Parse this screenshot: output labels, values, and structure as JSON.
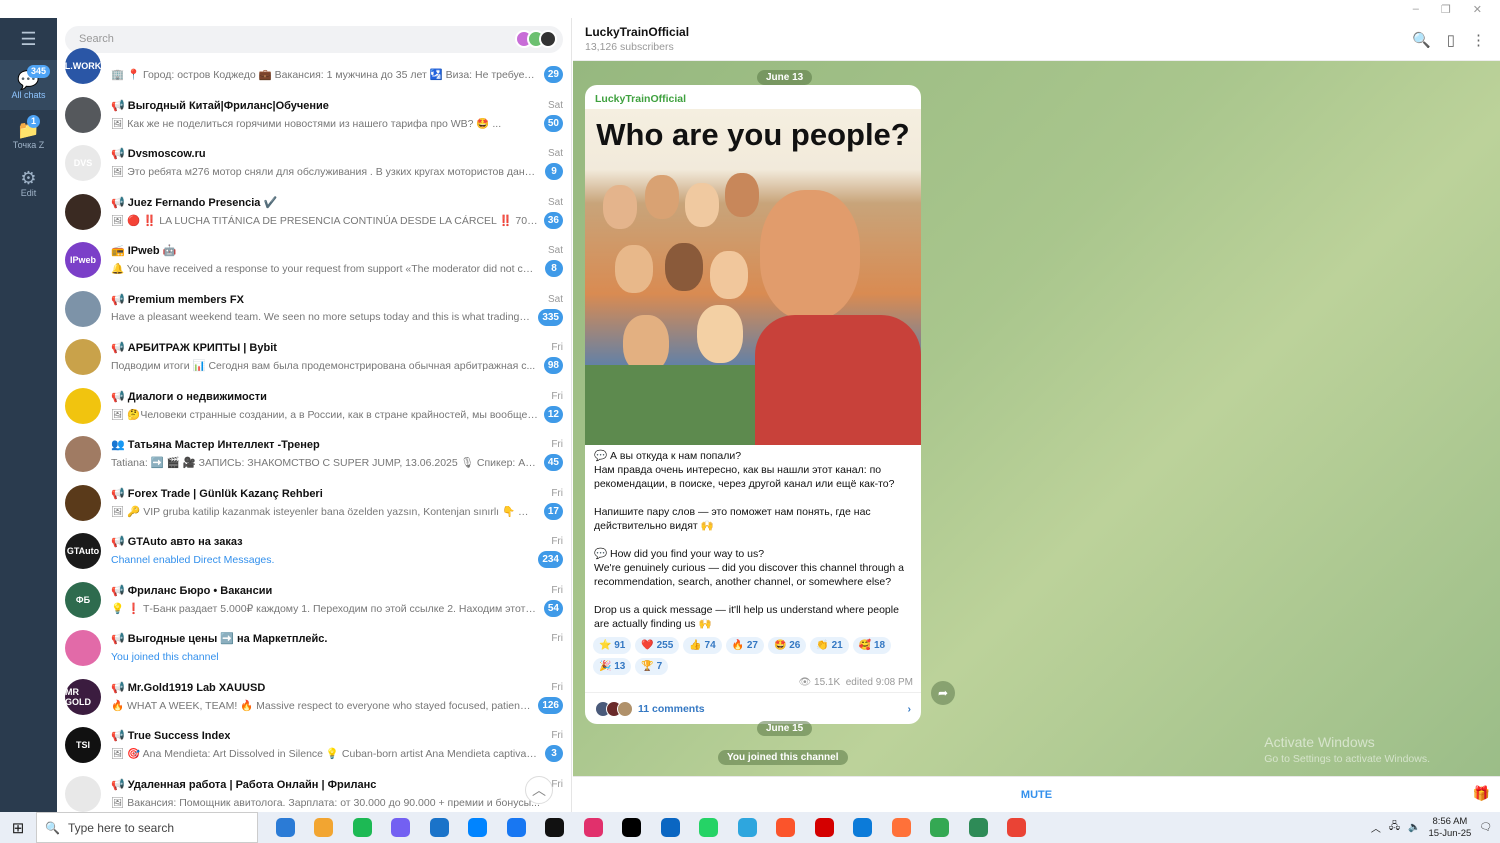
{
  "window": {
    "controls": [
      "–",
      "❐",
      "✕"
    ]
  },
  "rail": {
    "menu_icon": "hamburger-icon",
    "all_chats": {
      "label": "All chats",
      "badge": "345"
    },
    "folder": {
      "label": "Точка Z",
      "badge": "1"
    },
    "edit": {
      "label": "Edit"
    }
  },
  "search": {
    "placeholder": "Search"
  },
  "chats": [
    {
      "name": "",
      "date": "",
      "msg": "🏢 📍 Город: остров Коджедо 💼 Вакансия: 1 мужчина до 35 лет 🛂 Виза: Не требуетс...",
      "badge": "29",
      "avatar_color": "#2a56a6",
      "avatar_text": "L.WORK"
    },
    {
      "name": "📢 Выгодный Китай|Фриланс|Обучение",
      "date": "Sat",
      "msg": "🖼 Как же не поделиться горячими новостями из нашего тарифа про WB? 🤩 ...",
      "badge": "50",
      "avatar_color": "#55585c",
      "avatar_text": ""
    },
    {
      "name": "📢 Dvsmoscow.ru",
      "date": "Sat",
      "msg": "🖼 Это ребята м276 мотор сняли для обслуживания . В узких кругах мотористов данны...",
      "badge": "9",
      "avatar_color": "#e9e9e9",
      "avatar_text": "DVS"
    },
    {
      "name": "📢 Juez Fernando Presencia ✔️",
      "date": "Sat",
      "msg": "🖼 🔴 ‼️ LA LUCHA TITÁNICA DE PRESENCIA CONTINÚA DESDE LA CÁRCEL ‼️ 709 días secu...",
      "badge": "36",
      "avatar_color": "#3a2a22",
      "avatar_text": ""
    },
    {
      "name": "📻 IPweb 🤖",
      "date": "Sat",
      "msg": "🔔 You have received a response to your request from support «The moderator did not con...",
      "badge": "8",
      "avatar_color": "#7b3fc8",
      "avatar_text": "IPweb"
    },
    {
      "name": "📢 Premium members FX",
      "date": "Sat",
      "msg": "Have a pleasant weekend team. We seen no more setups today and this is what trading is l...",
      "badge": "335",
      "avatar_color": "#7d93a8",
      "avatar_text": ""
    },
    {
      "name": "📢 АРБИТРАЖ КРИПТЫ | Bybit",
      "date": "Fri",
      "msg": "Подводим итоги 📊 Сегодня вам была продемонстрирована обычная арбитражная с...",
      "badge": "98",
      "avatar_color": "#c9a24a",
      "avatar_text": ""
    },
    {
      "name": "📢 Диалоги о недвижимости",
      "date": "Fri",
      "msg": "🖼 🤔Человеки странные создании, а в России, как в стране крайностей, мы вообще п...",
      "badge": "12",
      "avatar_color": "#f1c40f",
      "avatar_text": ""
    },
    {
      "name": "👥 Татьяна Мастер Интеллект -Тренер",
      "date": "Fri",
      "msg": "Tatiana: ➡️ 🎬 🎥 ЗАПИСЬ: ЗНАКОМСТВО С SUPER JUMP, 13.06.2025 🎙 Спикер: Артём Я...",
      "badge": "45",
      "avatar_color": "#a07b63",
      "avatar_text": ""
    },
    {
      "name": "📢 Forex Trade | Günlük Kazanç Rehberi",
      "date": "Fri",
      "msg": "🖼 🔑 VIP gruba katilip kazanmak isteyenler bana özelden yazsın, Kontenjan sınırlı 👇 👇 ...",
      "badge": "17",
      "avatar_color": "#5a3a1a",
      "avatar_text": ""
    },
    {
      "name": "📢 GTAuto авто на заказ",
      "date": "Fri",
      "msg": "Channel enabled Direct Messages.",
      "badge": "234",
      "avatar_color": "#1a1a1a",
      "avatar_text": "GTAuto",
      "msg_blue": true
    },
    {
      "name": "📢 Фриланс Бюро • Вакансии",
      "date": "Fri",
      "msg": "💡 ❗ Т-Банк раздает 5.000₽ каждому 1. Переходим по этой ссылке 2. Находим этот по...",
      "badge": "54",
      "avatar_color": "#2e6b4e",
      "avatar_text": "ФБ"
    },
    {
      "name": "📢 Выгодные цены ➡️ на Маркетплейс.",
      "date": "Fri",
      "msg": "You joined this channel",
      "badge": "",
      "avatar_color": "#e26aa8",
      "avatar_text": "",
      "msg_blue": true
    },
    {
      "name": "📢 Mr.Gold1919 Lab XAUUSD",
      "date": "Fri",
      "msg": "🔥 WHAT A WEEK, TEAM! 🔥 Massive respect to everyone who stayed focused, patient, a...",
      "badge": "126",
      "avatar_color": "#3b1c3f",
      "avatar_text": "MR GOLD"
    },
    {
      "name": "📢 True Success Index",
      "date": "Fri",
      "msg": "🖼 🎯 Ana Mendieta: Art Dissolved in Silence 💡 Cuban-born artist Ana Mendieta captivate...",
      "badge": "3",
      "avatar_color": "#111111",
      "avatar_text": "TSI"
    },
    {
      "name": "📢 Удаленная работа | Работа Онлайн | Фриланс",
      "date": "Fri",
      "msg": "🖼 Вакансия: Помощник авитолога. Зарплата: от 30.000 до 90.000 + премии и бонусы...",
      "badge": "",
      "avatar_color": "#e8e8e8",
      "avatar_text": ""
    }
  ],
  "channel": {
    "title": "LuckyTrainOfficial",
    "subscribers": "13,126 subscribers"
  },
  "messages": {
    "date1": "June 13",
    "author": "LuckyTrainOfficial",
    "image_caption": "Who are you people?",
    "text": [
      "💬 А вы откуда к нам попали?",
      "Нам правда очень интересно, как вы нашли этот канал: по рекомендации, в поиске, через другой канал или ещё как-то?",
      "",
      "Напишите пару слов — это поможет нам понять, где нас действительно видят 🙌",
      "",
      "💬 How did you find your way to us?",
      "We're genuinely curious — did you discover this channel through a recommendation, search, another channel, or somewhere else?",
      "",
      "Drop us a quick message — it'll help us understand where people are actually finding us 🙌"
    ],
    "reactions": [
      {
        "emoji": "⭐",
        "count": "91"
      },
      {
        "emoji": "❤️",
        "count": "255"
      },
      {
        "emoji": "👍",
        "count": "74"
      },
      {
        "emoji": "🔥",
        "count": "27"
      },
      {
        "emoji": "🤩",
        "count": "26"
      },
      {
        "emoji": "👏",
        "count": "21"
      },
      {
        "emoji": "🥰",
        "count": "18"
      },
      {
        "emoji": "🎉",
        "count": "13"
      },
      {
        "emoji": "🏆",
        "count": "7"
      }
    ],
    "views": "15.1K",
    "edited": "edited 9:08 PM",
    "comments": "11 comments",
    "date2": "June 15",
    "service": "You joined this channel"
  },
  "watermark": {
    "line1": "Activate Windows",
    "line2": "Go to Settings to activate Windows."
  },
  "mute_label": "MUTE",
  "taskbar": {
    "search_placeholder": "Type here to search",
    "time": "8:56 AM",
    "date": "15-Jun-25",
    "apps": [
      "#2b7bd6",
      "#f2a531",
      "#1db954",
      "#7360f2",
      "#1a73c9",
      "#0084ff",
      "#1877f2",
      "#111111",
      "#e1306c",
      "#000000",
      "#0a66c2",
      "#25d366",
      "#2ea6de",
      "#fb542b",
      "#d40000",
      "#0c7bd9",
      "#ff7139",
      "#34a853",
      "#2e8b57",
      "#ea4335"
    ]
  }
}
